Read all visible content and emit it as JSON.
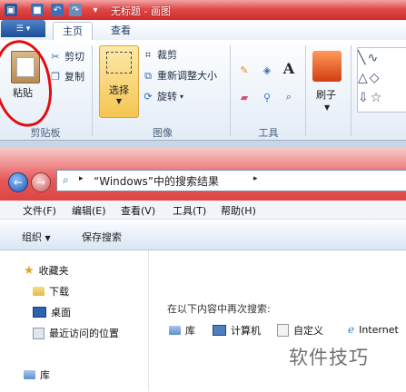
{
  "paint": {
    "title": "无标题 - 画图",
    "tabs": [
      "主页",
      "查看"
    ],
    "clipboard": {
      "paste": "粘贴",
      "cut": "剪切",
      "copy": "复制",
      "group": "剪贴板"
    },
    "image": {
      "select": "选择",
      "crop": "裁剪",
      "resize": "重新调整大小",
      "rotate": "旋转",
      "group": "图像"
    },
    "tools": {
      "group": "工具",
      "text_tool": "A"
    },
    "brushes": {
      "label": "刷子"
    }
  },
  "explorer": {
    "address": "“Windows”中的搜索结果",
    "menu": [
      "文件(F)",
      "编辑(E)",
      "查看(V)",
      "工具(T)",
      "帮助(H)"
    ],
    "commands": {
      "organize": "组织",
      "save_search": "保存搜索"
    },
    "favorites": {
      "label": "收藏夹",
      "items": [
        "下载",
        "桌面",
        "最近访问的位置"
      ]
    },
    "library": "库",
    "search_again": "在以下内容中再次搜索:",
    "locations": [
      "库",
      "计算机",
      "自定义",
      "Internet"
    ]
  },
  "watermark": "软件技巧",
  "colors": {
    "title_red": "#d22a2a",
    "circle_red": "#e40d0d",
    "ribbon_blue": "#e3ecf6"
  }
}
